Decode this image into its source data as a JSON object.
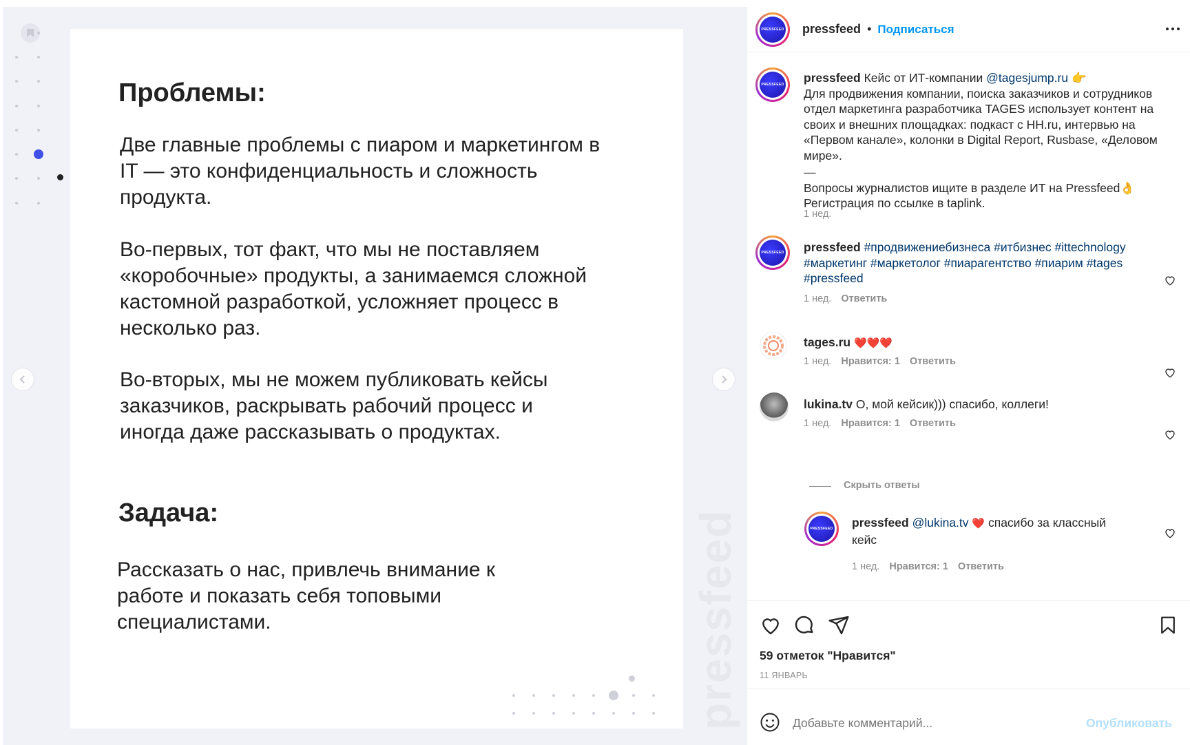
{
  "slide": {
    "heading_problems": "Проблемы:",
    "para1": "Две главные проблемы с пиаром и маркетингом в IT — это конфиденциальность и сложность продукта.",
    "para2": "Во-первых, тот факт, что мы не поставляем «коробочные» продукты, а занимаемся сложной кастомной разработкой, усложняет процесс в несколько раз.",
    "para3": "Во-вторых, мы не можем публиковать кейсы заказчиков, раскрывать рабочий процесс и иногда даже рассказывать о продуктах.",
    "heading_task": "Задача:",
    "para4": "Рассказать о нас, привлечь внимание к работе и показать себя топовыми специалистами.",
    "watermark": "pressfeed",
    "icons": {
      "prev": "chevron-left-icon",
      "next": "chevron-right-icon",
      "bookmark": "bookmark-icon"
    }
  },
  "header": {
    "username": "pressfeed",
    "separator": "•",
    "follow_label": "Подписаться",
    "more_icon": "more-horizontal-icon",
    "avatar_text": "PRESSFEED"
  },
  "caption": {
    "username": "pressfeed",
    "intro": "Кейс от ИТ-компании",
    "mention": "@tagesjump.ru",
    "emoji_point": "👉",
    "body": "Для продвижения компании, поиска заказчиков и сотрудников отдел маркетинга разработчика TAGES использует контент на своих и внешних площадках: подкаст с HH.ru, интервью на «Первом канале», колонки в Digital Report, Rusbase, «Деловом мире».",
    "dash": "—",
    "footer1": "Вопросы журналистов ищите в разделе ИТ на Pressfeed",
    "emoji_ok": "👌",
    "footer2": "Регистрация по ссылке в taplink.",
    "time": "1 нед."
  },
  "comments": [
    {
      "username": "pressfeed",
      "text": "#продвижениебизнеса #итбизнес #ittechnology #маркетинг #маркетолог #пиарагентство #пиарим #tages #pressfeed",
      "time": "1 нед.",
      "reply": "Ответить"
    },
    {
      "username": "tages.ru",
      "text": "❤️❤️❤️",
      "time": "1 нед.",
      "likes": "Нравится: 1",
      "reply": "Ответить"
    },
    {
      "username": "lukina.tv",
      "text": "О, мой кейсик))) спасибо, коллеги!",
      "time": "1 нед.",
      "likes": "Нравится: 1",
      "reply": "Ответить"
    }
  ],
  "hide_replies": "Скрыть ответы",
  "reply": {
    "username": "pressfeed",
    "mention": "@lukina.tv",
    "emoji": "❤️",
    "text_line1": "спасибо за классный",
    "text_line2": "кейс",
    "time": "1 нед.",
    "likes": "Нравится: 1",
    "reply": "Ответить"
  },
  "actions": {
    "like_icon": "heart-icon",
    "comment_icon": "comment-icon",
    "share_icon": "send-icon",
    "save_icon": "bookmark-icon",
    "likes_count": "59 отметок \"Нравится\"",
    "date": "11 ЯНВАРЬ"
  },
  "comment_box": {
    "emoji_icon": "smiley-icon",
    "placeholder": "Добавьте комментарий...",
    "publish_label": "Опубликовать"
  },
  "colors": {
    "accent": "#0095f6",
    "link": "#00376b",
    "slide_dot": "#3f51e6"
  }
}
